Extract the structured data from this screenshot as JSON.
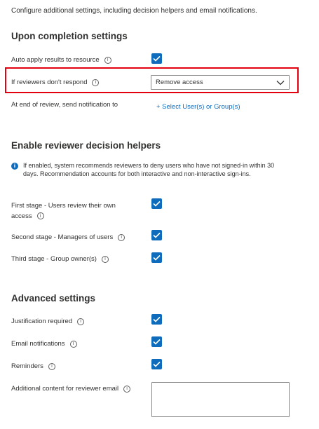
{
  "intro": "Configure additional settings, including decision helpers and email notifications.",
  "completion": {
    "title": "Upon completion settings",
    "auto_apply_label": "Auto apply results to resource",
    "no_response_label": "If reviewers don't respond",
    "no_response_value": "Remove access",
    "notify_label": "At end of review, send notification to",
    "notify_link": "+ Select User(s) or Group(s)"
  },
  "helpers": {
    "title": "Enable reviewer decision helpers",
    "info": "If enabled, system recommends reviewers to deny users who have not signed-in within 30 days. Recommendation accounts for both interactive and non-interactive sign-ins.",
    "first_stage_label": "First stage - Users review their own access",
    "second_stage_label": "Second stage - Managers of users",
    "third_stage_label": "Third stage - Group owner(s)"
  },
  "advanced": {
    "title": "Advanced settings",
    "justification_label": "Justification required",
    "email_label": "Email notifications",
    "reminders_label": "Reminders",
    "additional_content_label": "Additional content for reviewer email",
    "additional_content_value": ""
  },
  "checkboxes": {
    "auto_apply": true,
    "first_stage": true,
    "second_stage": true,
    "third_stage": true,
    "justification": true,
    "email": true,
    "reminders": true
  },
  "icons": {
    "info": "info-circle-icon",
    "check": "checkmark-icon",
    "chevron": "chevron-down-icon",
    "info_filled": "info-filled-icon"
  },
  "colors": {
    "accent": "#0f6cbd",
    "highlight": "#e3000f"
  }
}
